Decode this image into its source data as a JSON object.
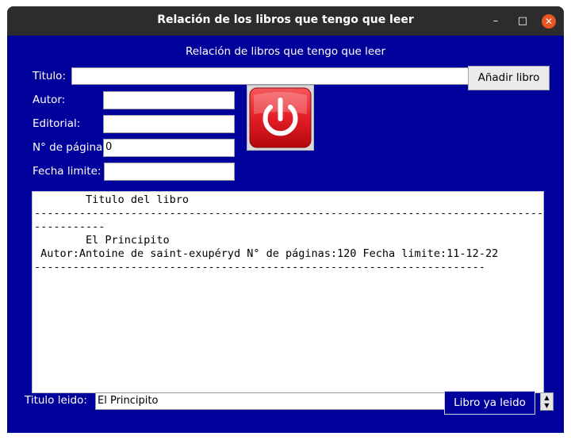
{
  "window": {
    "title": "Relación de los libros que tengo que leer",
    "controls": {
      "minimize": "–",
      "maximize": "□",
      "close": "✕"
    }
  },
  "form": {
    "heading": "Relación de libros que tengo que leer",
    "titulo_label": "Titulo:",
    "titulo_value": "",
    "autor_label": "Autor:",
    "autor_value": "",
    "editorial_label": "Editorial:",
    "editorial_value": "",
    "paginas_label": "N° de páginas:",
    "paginas_value": "0",
    "fecha_label": "Fecha limite:",
    "fecha_value": "",
    "add_button": "Añadir libro",
    "power_icon": "power-icon"
  },
  "book_list": {
    "header": "        Titulo del libro",
    "separator_long": "--------------------------------------------------------------------------------",
    "separator_wrap": "-----------",
    "book_title": "        El Principito",
    "book_details": " Autor:Antoine de saint-exupéryd N° de páginas:120 Fecha limite:11-12-22",
    "separator_short": "----------------------------------------------------------------------"
  },
  "bottom": {
    "read_label": "Titulo leido:",
    "read_value": "El Principito",
    "read_button": "Libro ya leido",
    "spin_up": "▲",
    "spin_down": "▼"
  },
  "colors": {
    "window_bg": "#00009a",
    "titlebar_bg": "#2c2c2c",
    "close_button": "#e95420",
    "power_button": "#e41e26"
  }
}
